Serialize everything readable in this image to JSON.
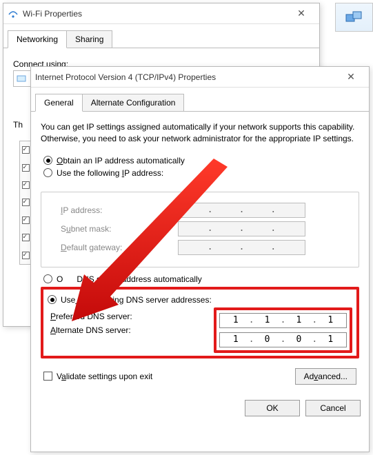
{
  "back_window": {
    "title": "Wi-Fi Properties",
    "tabs": [
      "Networking",
      "Sharing"
    ],
    "connect_label": "Connect using:",
    "this_label": "Th"
  },
  "dialog": {
    "title": "Internet Protocol Version 4 (TCP/IPv4) Properties",
    "tabs": [
      "General",
      "Alternate Configuration"
    ],
    "description": "You can get IP settings assigned automatically if your network supports this capability. Otherwise, you need to ask your network administrator for the appropriate IP settings.",
    "ip": {
      "auto_label": "Obtain an IP address automatically",
      "manual_label": "Use the following IP address:",
      "selected": "auto",
      "fields": {
        "ip_label": "IP address:",
        "subnet_label": "Subnet mask:",
        "gateway_label": "Default gateway:"
      }
    },
    "dns": {
      "auto_label": "Obtain DNS server address automatically",
      "manual_label": "Use the following DNS server addresses:",
      "selected": "manual",
      "preferred_label": "Preferred DNS server:",
      "alternate_label": "Alternate DNS server:",
      "preferred": [
        "1",
        "1",
        "1",
        "1"
      ],
      "alternate": [
        "1",
        "0",
        "0",
        "1"
      ]
    },
    "validate_label": "Validate settings upon exit",
    "advanced_label": "Advanced...",
    "ok": "OK",
    "cancel": "Cancel"
  },
  "highlight_color": "#e21a1a"
}
